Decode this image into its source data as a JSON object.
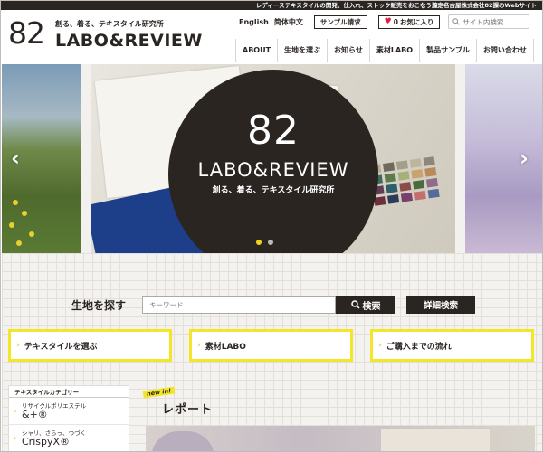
{
  "top_strip": "レディーステキスタイルの開発、仕入れ、ストック販売をおこなう瀧定名古屋株式会社82課のWebサイト",
  "logo": {
    "number": "82",
    "tagline": "創る、着る、テキスタイル研究所",
    "name": "LABO&REVIEW"
  },
  "utility": {
    "english": "English",
    "chinese": "简体中文",
    "sample_request": "サンプル請求",
    "favorites_count": "0",
    "favorites_label": "お気に入り",
    "search_placeholder": "サイト内検索"
  },
  "nav": [
    "ABOUT",
    "生地を選ぶ",
    "お知らせ",
    "素材LABO",
    "製品サンプル",
    "お問い合わせ"
  ],
  "hero": {
    "number": "82",
    "name": "LABO&REVIEW",
    "tagline": "創る、着る、テキスタイル研究所",
    "prev": "‹",
    "next": "›",
    "swatches": [
      "#9a8e77",
      "#b7ad93",
      "#6f6a5b",
      "#a3a089",
      "#bfb59c",
      "#8e8778",
      "#7c4f4a",
      "#3f6b5c",
      "#5c7a4b",
      "#a7b07a",
      "#c9a36b",
      "#b98a5a",
      "#3e4a6e",
      "#5e3d55",
      "#2f5f6a",
      "#8a4b4b",
      "#4a6b3c",
      "#8e6d8a",
      "#b44d5f",
      "#6e2f3c",
      "#2d3b56",
      "#7a3e6e",
      "#c46e6e",
      "#556b9a"
    ],
    "slide_count": 2,
    "active_slide": 1
  },
  "finder": {
    "label": "生地を探す",
    "placeholder": "キーワード",
    "search_button": "検索",
    "detail_button": "詳細検索"
  },
  "cards": [
    "テキスタイルを選ぶ",
    "素材LABO",
    "ご購入までの流れ"
  ],
  "sidebar": {
    "heading": "テキスタイルカテゴリー",
    "items": [
      {
        "line1": "リサイクルポリエステル",
        "line2": "&+®"
      },
      {
        "line1": "シャリ、さらっ、つづく",
        "line2": "CrispyX®"
      }
    ]
  },
  "report": {
    "badge": "new in!",
    "title": "レポート"
  }
}
